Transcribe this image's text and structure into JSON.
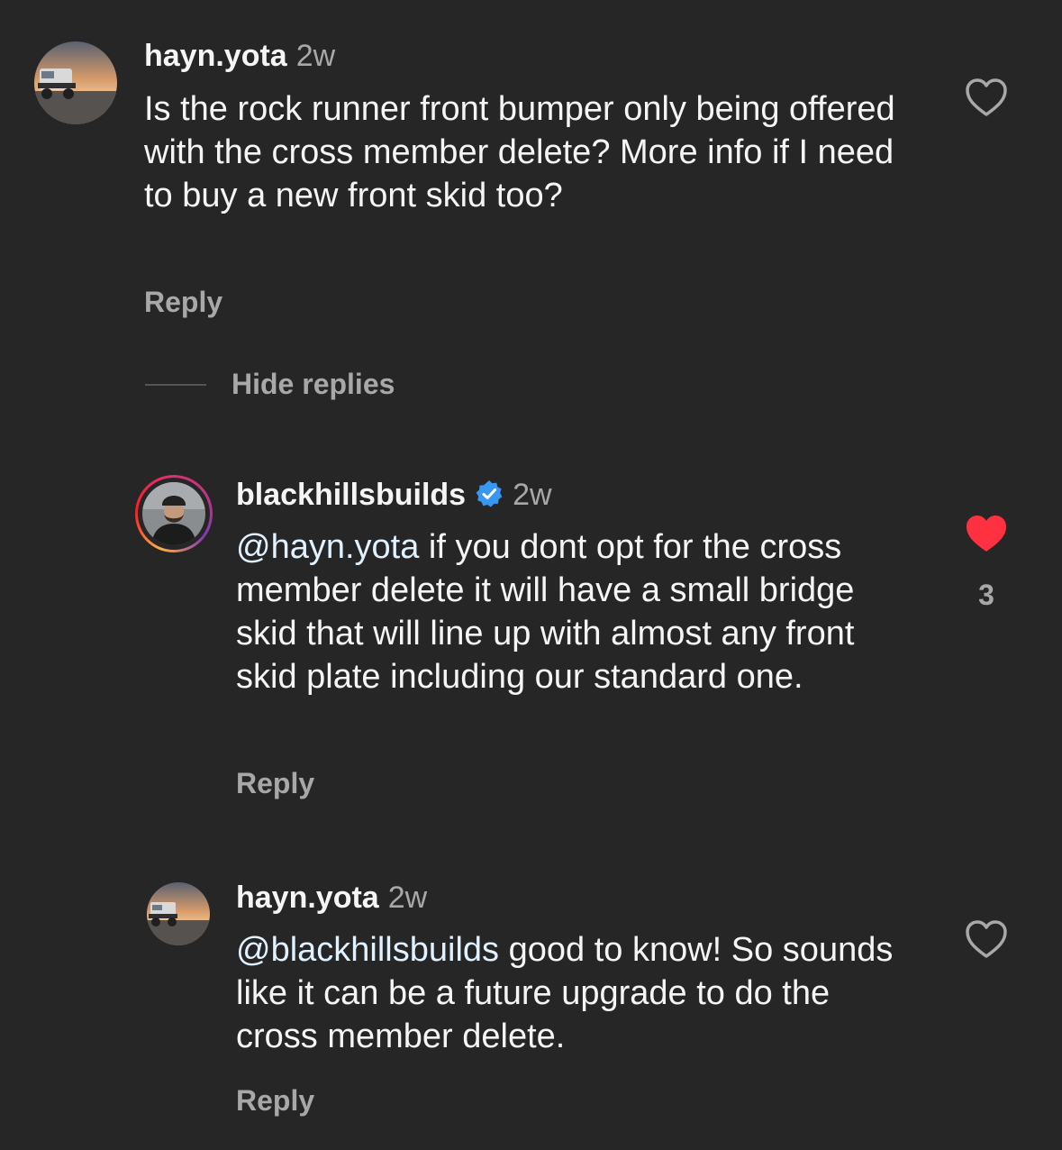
{
  "comments": [
    {
      "username": "hayn.yota",
      "time": "2w",
      "text": "Is the rock runner front bumper only being offered with the cross member delete? More info if I need to buy a new front skid too?",
      "reply_label": "Reply",
      "liked": false
    }
  ],
  "thread": {
    "hide_replies_label": "Hide replies"
  },
  "replies": [
    {
      "username": "blackhillsbuilds",
      "verified": true,
      "time": "2w",
      "mention": "@hayn.yota",
      "text": " if you dont opt for the cross member delete it will have a small bridge skid that will line up with almost any front skid plate including our standard one.",
      "reply_label": "Reply",
      "liked": true,
      "like_count": "3"
    },
    {
      "username": "hayn.yota",
      "time": "2w",
      "mention": "@blackhillsbuilds",
      "text": " good to know! So sounds like it can be a future upgrade to do the cross member delete.",
      "reply_label": "Reply",
      "liked": false
    }
  ],
  "colors": {
    "background": "#262626",
    "text": "#f5f5f5",
    "secondary": "#a8a8a8",
    "mention": "#e0f1ff",
    "like_red": "#ff3040",
    "verified_blue": "#3897f0"
  },
  "icons": {
    "heart_outline": "heart-outline-icon",
    "heart_filled": "heart-filled-icon",
    "verified": "verified-badge-icon"
  }
}
